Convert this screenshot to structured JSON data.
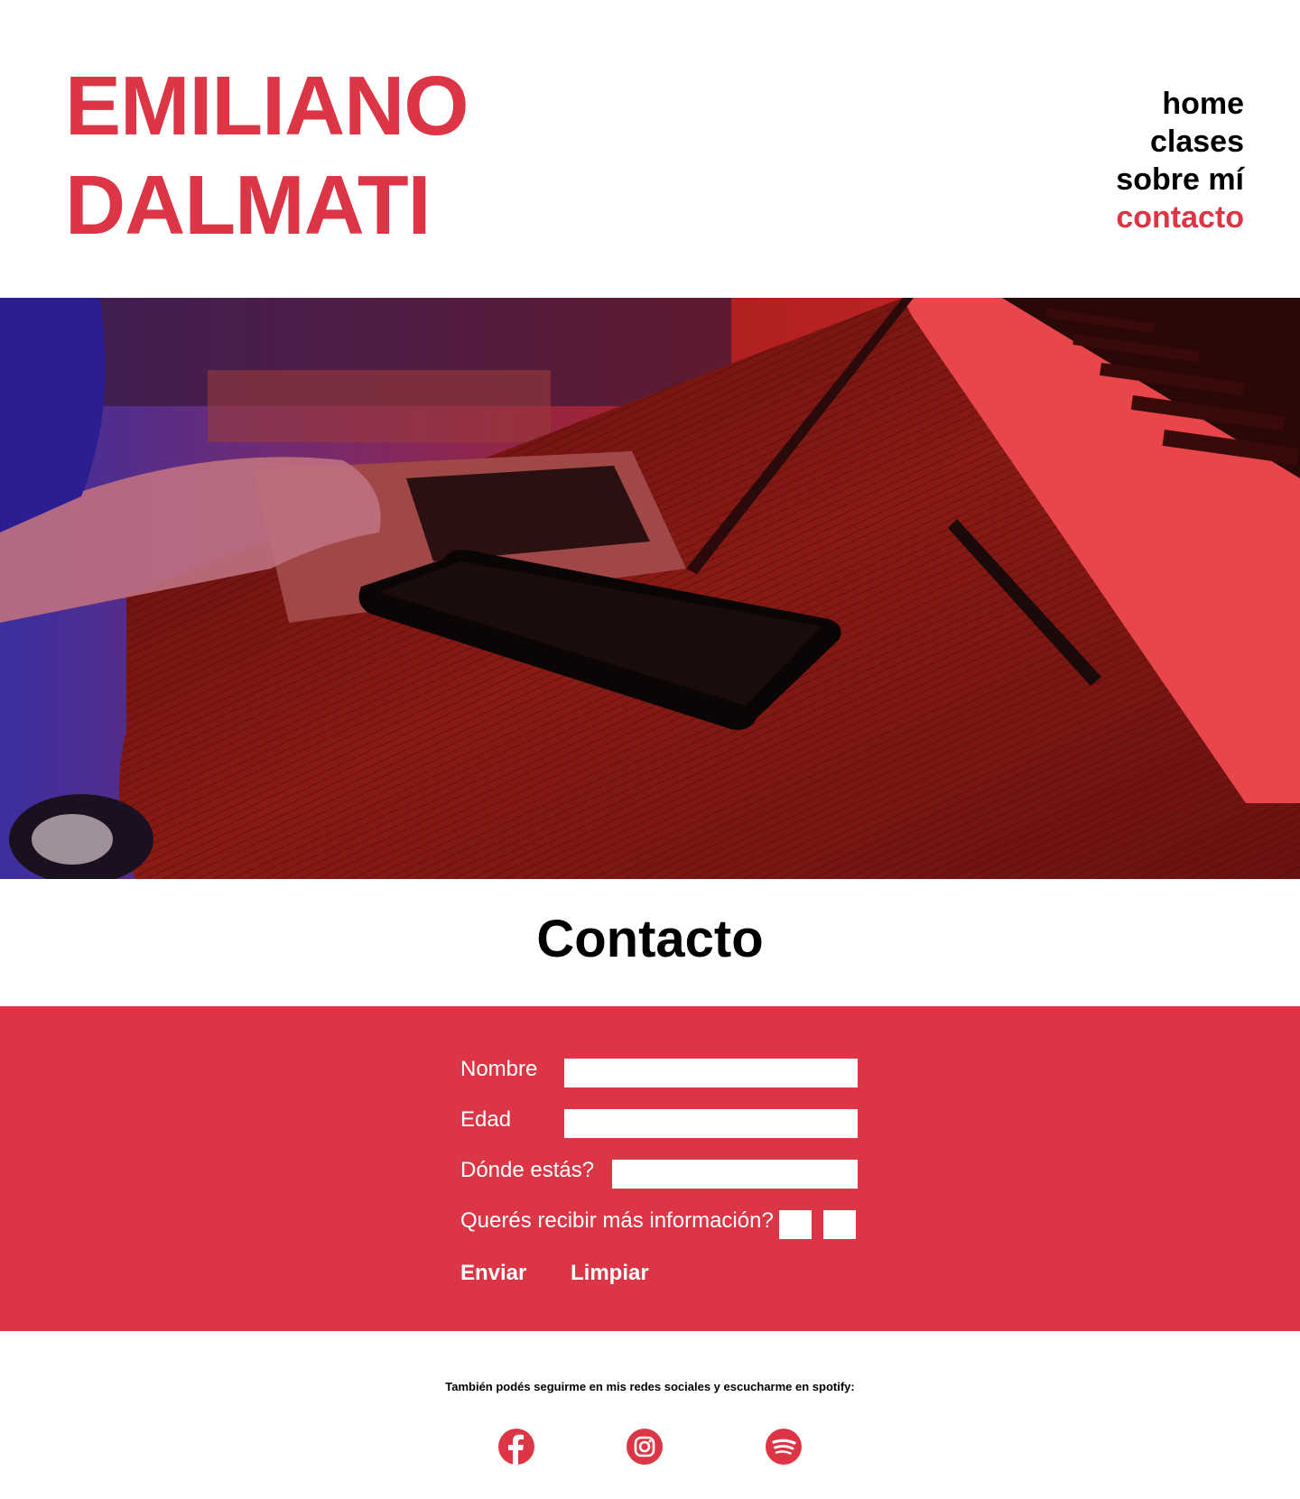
{
  "header": {
    "title_line1": "EMILIANO",
    "title_line2": "DALMATI",
    "nav": {
      "home": "home",
      "clases": "clases",
      "sobre": "sobre mí",
      "contacto": "contacto"
    }
  },
  "hero": {
    "alt": "Escritorio con laptop, teléfono y teclado musical"
  },
  "contact": {
    "title": "Contacto",
    "form": {
      "nombre_label": "Nombre",
      "nombre_value": "",
      "edad_label": "Edad",
      "edad_value": "",
      "donde_label": "Dónde estás?",
      "donde_value": "",
      "info_label": "Querés recibir más información?",
      "submit_label": "Enviar",
      "reset_label": "Limpiar"
    }
  },
  "footer": {
    "note": "También podés seguirme en mis redes sociales y escucharme en spotify:",
    "icons": [
      "facebook-icon",
      "instagram-icon",
      "spotify-icon"
    ]
  },
  "colors": {
    "accent": "#dc3545",
    "text": "#000000",
    "background": "#ffffff"
  }
}
